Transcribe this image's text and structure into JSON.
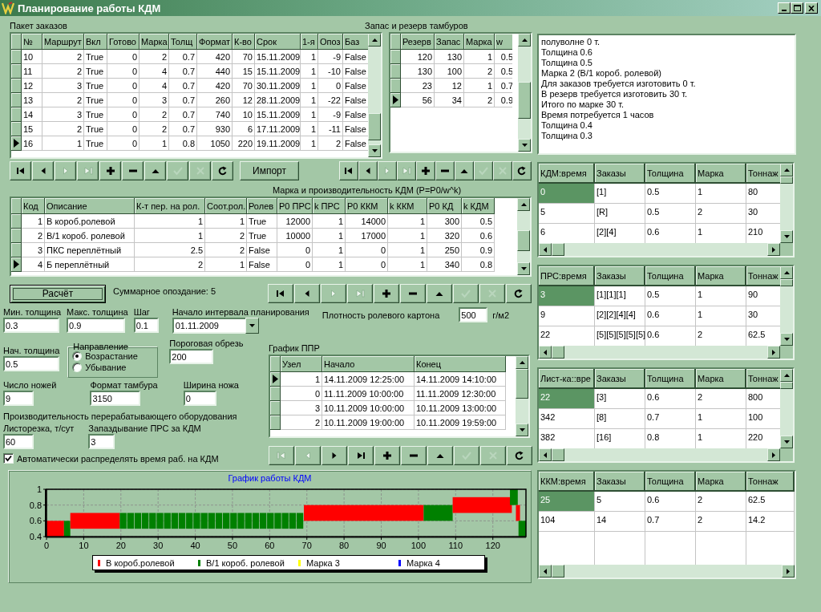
{
  "window": {
    "title": "Планирование работы КДМ"
  },
  "orders": {
    "label": "Пакет заказов",
    "columns": [
      "№",
      "Маршрут",
      "Вкл",
      "Готово",
      "Марка",
      "Толщ",
      "Формат",
      "К-во",
      "Срок",
      "1-я",
      "Опоз",
      "Баз"
    ],
    "rows": [
      {
        "cells": [
          "10",
          "2",
          "True",
          "0",
          "2",
          "0.7",
          "420",
          "70",
          "15.11.2009",
          "1",
          "-9",
          "False"
        ],
        "selected": false
      },
      {
        "cells": [
          "11",
          "2",
          "True",
          "0",
          "4",
          "0.7",
          "440",
          "15",
          "15.11.2009",
          "1",
          "-10",
          "False"
        ],
        "selected": false
      },
      {
        "cells": [
          "12",
          "3",
          "True",
          "0",
          "4",
          "0.7",
          "420",
          "70",
          "30.11.2009",
          "1",
          "0",
          "False"
        ],
        "selected": false
      },
      {
        "cells": [
          "13",
          "2",
          "True",
          "0",
          "3",
          "0.7",
          "260",
          "12",
          "28.11.2009",
          "1",
          "-22",
          "False"
        ],
        "selected": false
      },
      {
        "cells": [
          "14",
          "3",
          "True",
          "0",
          "2",
          "0.7",
          "740",
          "10",
          "15.11.2009",
          "1",
          "-9",
          "False"
        ],
        "selected": false
      },
      {
        "cells": [
          "15",
          "2",
          "True",
          "0",
          "2",
          "0.7",
          "930",
          "6",
          "17.11.2009",
          "1",
          "-11",
          "False"
        ],
        "selected": false
      },
      {
        "cells": [
          "16",
          "1",
          "True",
          "0",
          "1",
          "0.8",
          "1050",
          "220",
          "19.11.2009",
          "1",
          "2",
          "False"
        ],
        "selected": true
      }
    ],
    "nav": [
      {
        "kind": "first",
        "disabled": false
      },
      {
        "kind": "prior",
        "disabled": false
      },
      {
        "kind": "next",
        "disabled": true
      },
      {
        "kind": "last",
        "disabled": true
      },
      {
        "kind": "insert",
        "disabled": false
      },
      {
        "kind": "delete",
        "disabled": false
      },
      {
        "kind": "edit",
        "disabled": false
      },
      {
        "kind": "post",
        "disabled": true
      },
      {
        "kind": "cancel",
        "disabled": true
      },
      {
        "kind": "refresh",
        "disabled": false
      }
    ],
    "import_button": "Импорт"
  },
  "reserves": {
    "label": "Запас и резерв тамбуров",
    "columns": [
      "Резерв",
      "Запас",
      "Марка",
      "w"
    ],
    "rows": [
      {
        "cells": [
          "120",
          "130",
          "1",
          "0.5"
        ],
        "selected": false
      },
      {
        "cells": [
          "130",
          "100",
          "2",
          "0.5"
        ],
        "selected": false
      },
      {
        "cells": [
          "23",
          "12",
          "1",
          "0.7"
        ],
        "selected": false
      },
      {
        "cells": [
          "56",
          "34",
          "2",
          "0.9"
        ],
        "selected": true
      }
    ],
    "nav": [
      {
        "kind": "first",
        "disabled": false
      },
      {
        "kind": "prior",
        "disabled": false
      },
      {
        "kind": "next",
        "disabled": true
      },
      {
        "kind": "last",
        "disabled": true
      },
      {
        "kind": "insert",
        "disabled": false
      },
      {
        "kind": "delete",
        "disabled": false
      },
      {
        "kind": "edit",
        "disabled": false
      },
      {
        "kind": "post",
        "disabled": true
      },
      {
        "kind": "cancel",
        "disabled": true
      },
      {
        "kind": "refresh",
        "disabled": false
      }
    ]
  },
  "log": {
    "lines": [
      "полуволне 0 т.",
      "Толщина 0.6",
      "Толщина 0.5",
      "Марка 2 (В/1 короб. ролевой)",
      "Для заказов требуется изготовить 0 т.",
      "В резерв требуется изготовить 30 т.",
      "Итого по марке 30 т.",
      "Время потребуется 1 часов",
      "Толщина 0.4",
      "Толщина 0.3"
    ]
  },
  "marks": {
    "title": "Марка и производительность КДМ (P=P0/w^k)",
    "columns": [
      "Код",
      "Описание",
      "К-т пер. на рол.",
      "Соот.рол.",
      "Ролев",
      "P0 ПРС",
      "k ПРС",
      "P0 ККМ",
      "k ККМ",
      "P0 КД",
      "k КДМ"
    ],
    "rows": [
      {
        "cells": [
          "1",
          "В короб.ролевой",
          "1",
          "1",
          "True",
          "12000",
          "1",
          "14000",
          "1",
          "300",
          "0.5"
        ],
        "selected": false
      },
      {
        "cells": [
          "2",
          "В/1 короб. ролевой",
          "1",
          "2",
          "True",
          "10000",
          "1",
          "17000",
          "1",
          "320",
          "0.6"
        ],
        "selected": false
      },
      {
        "cells": [
          "3",
          "ПКС переплётный",
          "2.5",
          "2",
          "False",
          "0",
          "1",
          "0",
          "1",
          "250",
          "0.9"
        ],
        "selected": false
      },
      {
        "cells": [
          "4",
          "Б переплётный",
          "2",
          "1",
          "False",
          "0",
          "1",
          "0",
          "1",
          "340",
          "0.8"
        ],
        "selected": true
      }
    ],
    "nav": [
      {
        "kind": "first",
        "disabled": false
      },
      {
        "kind": "prior",
        "disabled": false
      },
      {
        "kind": "next",
        "disabled": true
      },
      {
        "kind": "last",
        "disabled": true
      },
      {
        "kind": "insert",
        "disabled": false
      },
      {
        "kind": "delete",
        "disabled": false
      },
      {
        "kind": "edit",
        "disabled": false
      },
      {
        "kind": "post",
        "disabled": true
      },
      {
        "kind": "cancel",
        "disabled": true
      },
      {
        "kind": "refresh",
        "disabled": false
      }
    ]
  },
  "calc": {
    "button": "Расчёт",
    "summary": "Суммарное опоздание: 5"
  },
  "params": {
    "min_thickness": {
      "label": "Мин. толщина",
      "value": "0.3"
    },
    "max_thickness": {
      "label": "Макс. толщина",
      "value": "0.9"
    },
    "step": {
      "label": "Шаг",
      "value": "0.1"
    },
    "planning_start": {
      "label": "Начало интервала планирования",
      "value": "01.11.2009"
    },
    "density": {
      "label": "Плотность ролевого картона",
      "value": "500",
      "unit": "г/м2"
    },
    "start_thickness": {
      "label": "Нач. толщина",
      "value": "0.5"
    },
    "direction": {
      "label": "Направление",
      "options": [
        {
          "label": "Возрастание",
          "selected": true
        },
        {
          "label": "Убывание",
          "selected": false
        }
      ]
    },
    "trim_threshold": {
      "label": "Пороговая обрезь",
      "value": "200"
    },
    "knives": {
      "label": "Число ножей",
      "value": "9"
    },
    "reel_format": {
      "label": "Формат тамбура",
      "value": "3150"
    },
    "knife_width": {
      "label": "Ширина ножа",
      "value": "0"
    },
    "productivity_label": "Производительность перерабатывающего оборудования",
    "sheeter": {
      "label": "Листорезка, т/сут",
      "value": "60"
    },
    "prs_delay": {
      "label": "Запаздывание ПРС за КДМ",
      "value": "3"
    },
    "auto_distribute": {
      "label": "Автоматически распределять время раб. на КДМ",
      "checked": true
    }
  },
  "ppr": {
    "label": "График ППР",
    "columns": [
      "Узел",
      "Начало",
      "Конец"
    ],
    "rows": [
      {
        "cells": [
          "1",
          "14.11.2009 12:25:00",
          "14.11.2009 14:10:00"
        ],
        "selected": true
      },
      {
        "cells": [
          "0",
          "11.11.2009 10:00:00",
          "11.11.2009 12:30:00"
        ],
        "selected": false
      },
      {
        "cells": [
          "3",
          "10.11.2009 10:00:00",
          "10.11.2009 13:00:00"
        ],
        "selected": false
      },
      {
        "cells": [
          "2",
          "10.11.2009 19:00:00",
          "10.11.2009 19:59:00"
        ],
        "selected": false
      }
    ],
    "nav": [
      {
        "kind": "first",
        "disabled": true
      },
      {
        "kind": "prior",
        "disabled": true
      },
      {
        "kind": "next",
        "disabled": false
      },
      {
        "kind": "last",
        "disabled": false
      },
      {
        "kind": "insert",
        "disabled": false
      },
      {
        "kind": "delete",
        "disabled": false
      },
      {
        "kind": "edit",
        "disabled": false
      },
      {
        "kind": "post",
        "disabled": true
      },
      {
        "kind": "cancel",
        "disabled": true
      },
      {
        "kind": "refresh",
        "disabled": false
      }
    ]
  },
  "chart": {
    "title": "График работы КДМ",
    "x_ticks": [
      "0",
      "10",
      "20",
      "30",
      "40",
      "50",
      "60",
      "70",
      "80",
      "90",
      "100",
      "110",
      "120"
    ],
    "y_ticks": [
      "1",
      "0.8",
      "0.6",
      "0.4"
    ],
    "legend": [
      {
        "name": "В короб.ролевой",
        "color": "#ff0000"
      },
      {
        "name": "В/1 короб. ролевой",
        "color": "#008000"
      },
      {
        "name": "Марка 3",
        "color": "#ffff00"
      },
      {
        "name": "Марка 4",
        "color": "#0000ff"
      }
    ]
  },
  "schedules": [
    {
      "columns": [
        "КДМ:время",
        "Заказы",
        "Толщина",
        "Марка",
        "Тоннаж"
      ],
      "rows": [
        {
          "cells": [
            "0",
            "[1]",
            "0.5",
            "1",
            "80"
          ],
          "selected": true
        },
        {
          "cells": [
            "5",
            "[R]",
            "0.5",
            "2",
            "30"
          ],
          "selected": false
        },
        {
          "cells": [
            "6",
            "[2][4]",
            "0.6",
            "1",
            "210"
          ],
          "selected": false
        }
      ]
    },
    {
      "columns": [
        "ПРС:время",
        "Заказы",
        "Толщина",
        "Марка",
        "Тоннаж"
      ],
      "rows": [
        {
          "cells": [
            "3",
            "[1][1][1]",
            "0.5",
            "1",
            "90"
          ],
          "selected": true
        },
        {
          "cells": [
            "9",
            "[2][2][4][4]",
            "0.6",
            "1",
            "30"
          ],
          "selected": false
        },
        {
          "cells": [
            "22",
            "[5][5][5][5][5]",
            "0.6",
            "2",
            "62.5"
          ],
          "selected": false
        }
      ]
    },
    {
      "columns": [
        "Лист-ка::вре",
        "Заказы",
        "Толщина",
        "Марка",
        "Тоннаж"
      ],
      "rows": [
        {
          "cells": [
            "22",
            "[3]",
            "0.6",
            "2",
            "800"
          ],
          "selected": true
        },
        {
          "cells": [
            "342",
            "[8]",
            "0.7",
            "1",
            "100"
          ],
          "selected": false
        },
        {
          "cells": [
            "382",
            "[16]",
            "0.8",
            "1",
            "220"
          ],
          "selected": false
        }
      ]
    },
    {
      "columns": [
        "ККМ:время",
        "Заказы",
        "Толщина",
        "Марка",
        "Тоннаж"
      ],
      "rows": [
        {
          "cells": [
            "25",
            "5",
            "0.6",
            "2",
            "62.5"
          ],
          "selected": true
        },
        {
          "cells": [
            "104",
            "14",
            "0.7",
            "2",
            "14.2"
          ],
          "selected": false
        }
      ]
    }
  ]
}
